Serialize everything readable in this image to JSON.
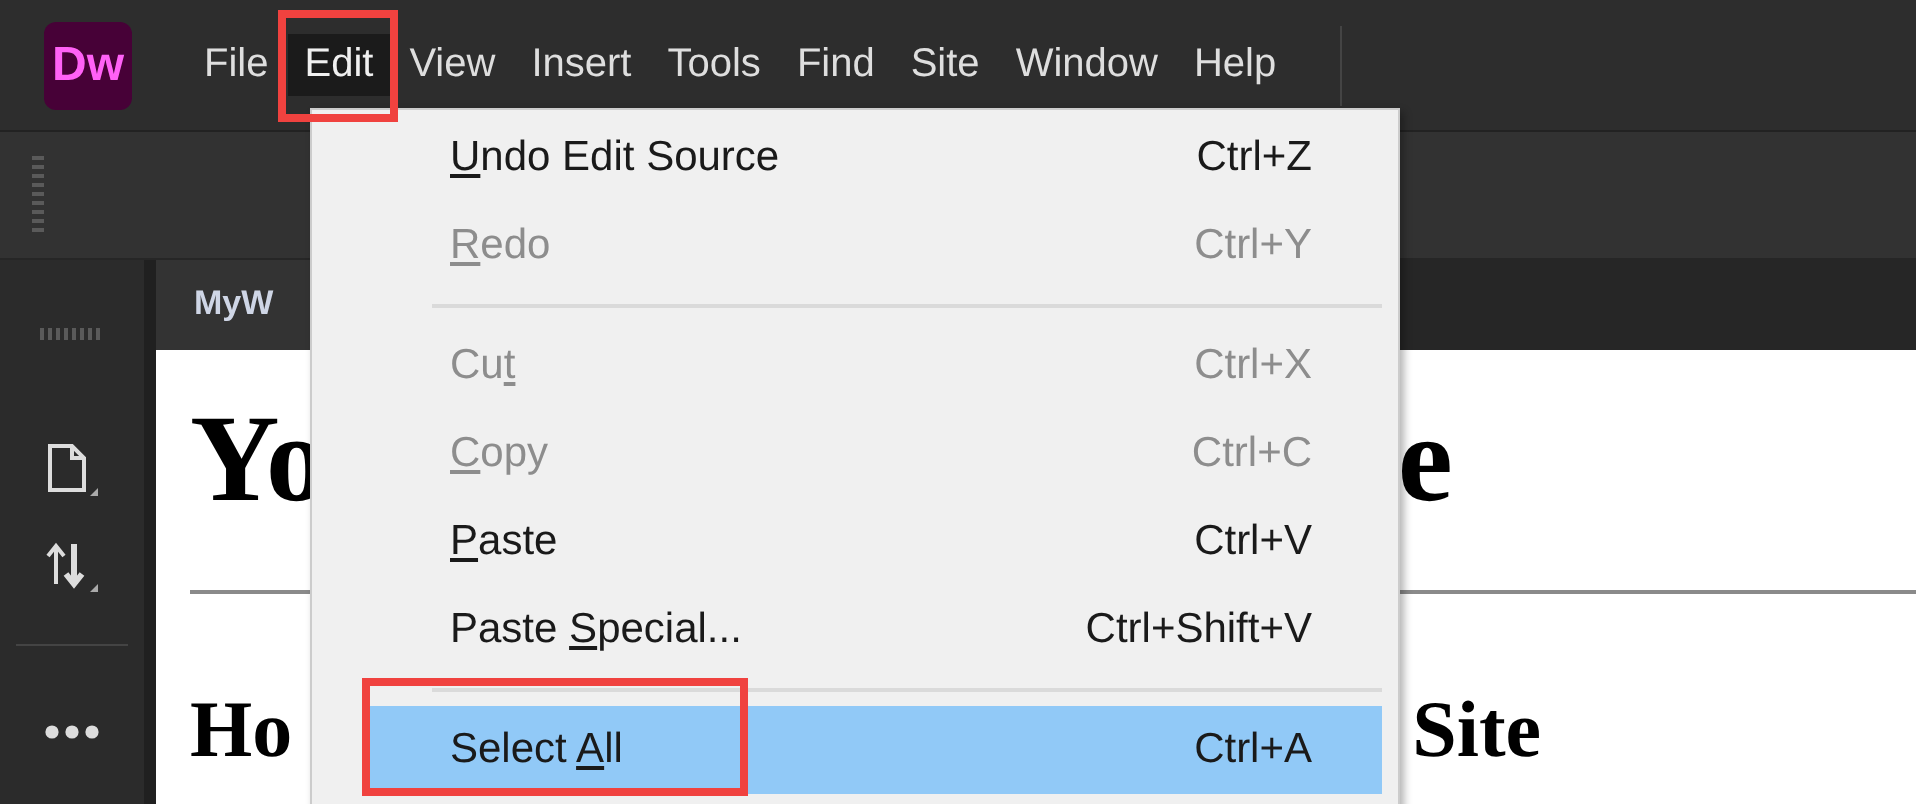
{
  "app": {
    "logo": "Dw"
  },
  "menubar": [
    {
      "label": "File",
      "selected": false
    },
    {
      "label": "Edit",
      "selected": true
    },
    {
      "label": "View",
      "selected": false
    },
    {
      "label": "Insert",
      "selected": false
    },
    {
      "label": "Tools",
      "selected": false
    },
    {
      "label": "Find",
      "selected": false
    },
    {
      "label": "Site",
      "selected": false
    },
    {
      "label": "Window",
      "selected": false
    },
    {
      "label": "Help",
      "selected": false
    }
  ],
  "document_tab": {
    "label": "MyW"
  },
  "document": {
    "heading_1": {
      "left": "Yo",
      "right": "e"
    },
    "heading_2": {
      "left": "Ho",
      "right": "Site"
    }
  },
  "edit_menu": [
    {
      "kind": "item",
      "label": {
        "key": "U",
        "after": "ndo Edit Source"
      },
      "shortcut": "Ctrl+Z",
      "disabled": false,
      "selected": false
    },
    {
      "kind": "item",
      "label": {
        "key": "R",
        "after": "edo"
      },
      "shortcut": "Ctrl+Y",
      "disabled": true,
      "selected": false
    },
    {
      "kind": "separator"
    },
    {
      "kind": "item",
      "label": {
        "before": "Cu",
        "key": "t"
      },
      "shortcut": "Ctrl+X",
      "disabled": true,
      "selected": false
    },
    {
      "kind": "item",
      "label": {
        "key": "C",
        "after": "opy"
      },
      "shortcut": "Ctrl+C",
      "disabled": true,
      "selected": false
    },
    {
      "kind": "item",
      "label": {
        "key": "P",
        "after": "aste"
      },
      "shortcut": "Ctrl+V",
      "disabled": false,
      "selected": false
    },
    {
      "kind": "item",
      "label": {
        "before": "Paste ",
        "key": "S",
        "after": "pecial..."
      },
      "shortcut": "Ctrl+Shift+V",
      "disabled": false,
      "selected": false
    },
    {
      "kind": "separator"
    },
    {
      "kind": "item",
      "label": {
        "before": "Select ",
        "key": "A",
        "after": "ll"
      },
      "shortcut": "Ctrl+A",
      "disabled": false,
      "selected": true
    }
  ]
}
